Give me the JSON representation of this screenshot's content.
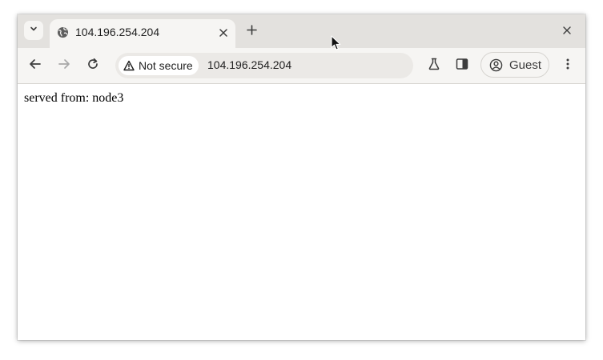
{
  "tab": {
    "title": "104.196.254.204",
    "favicon": "globe-icon"
  },
  "toolbar": {
    "security_label": "Not secure",
    "url": "104.196.254.204",
    "profile_label": "Guest"
  },
  "content": {
    "text": "served from: node3"
  },
  "colors": {
    "tabstrip_bg": "#e3e1de",
    "toolbar_bg": "#f6f5f3",
    "omnibox_bg": "#ebe9e6",
    "icon": "#3c3c3c"
  }
}
